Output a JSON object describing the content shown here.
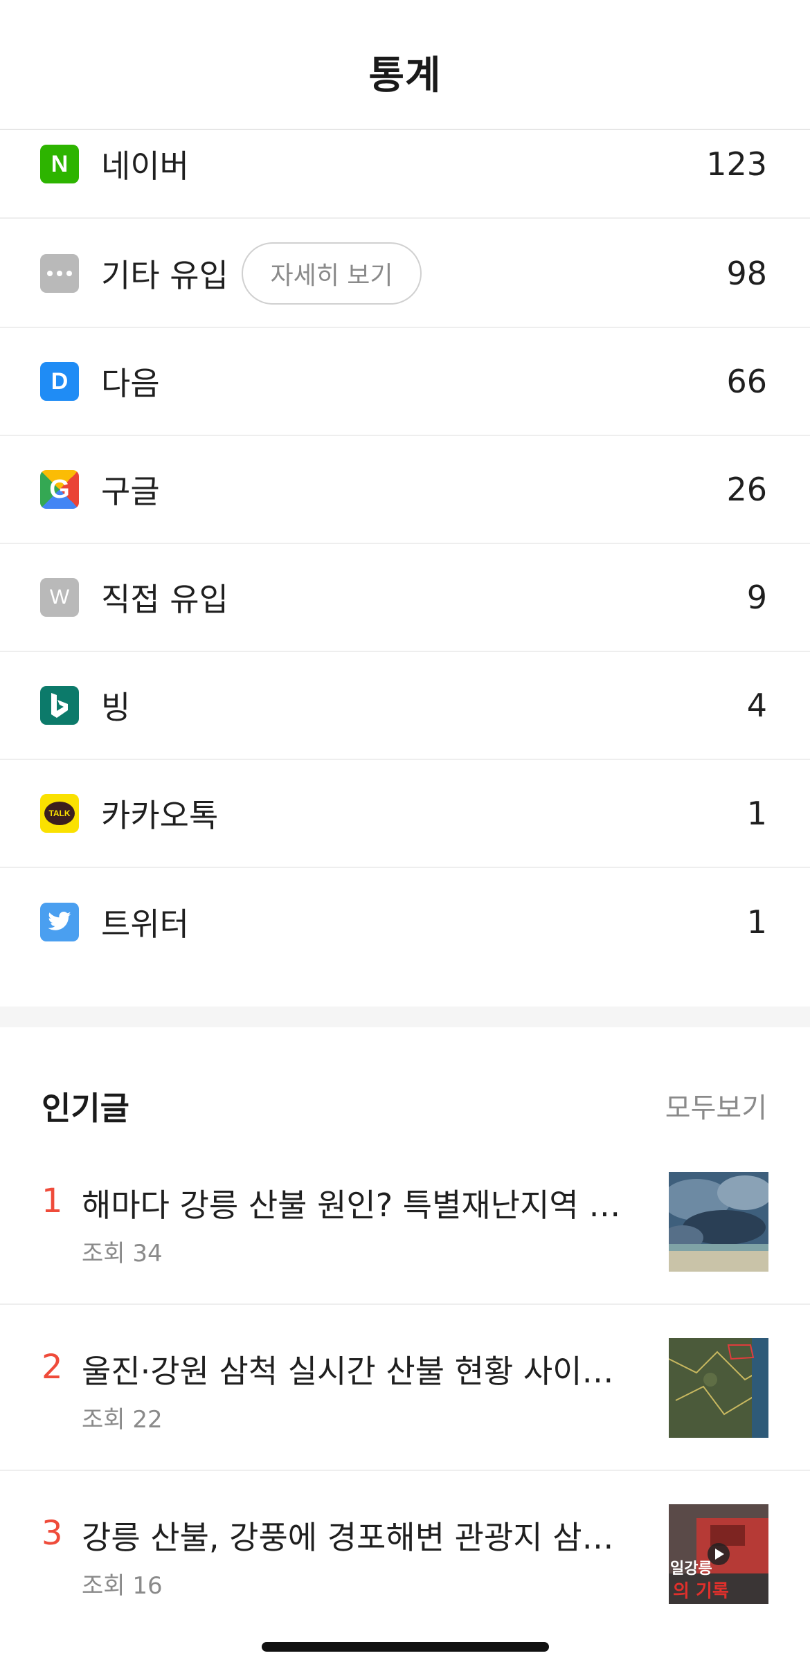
{
  "header": {
    "title": "통계"
  },
  "referrers": [
    {
      "icon": "naver-icon",
      "label": "네이버",
      "count": "123"
    },
    {
      "icon": "more-icon",
      "label": "기타 유입",
      "count": "98",
      "detail_button": "자세히 보기"
    },
    {
      "icon": "daum-icon",
      "label": "다음",
      "count": "66"
    },
    {
      "icon": "google-icon",
      "label": "구글",
      "count": "26"
    },
    {
      "icon": "direct-icon",
      "label": "직접 유입",
      "count": "9"
    },
    {
      "icon": "bing-icon",
      "label": "빙",
      "count": "4"
    },
    {
      "icon": "kakaotalk-icon",
      "label": "카카오톡",
      "count": "1"
    },
    {
      "icon": "twitter-icon",
      "label": "트위터",
      "count": "1"
    }
  ],
  "icon_text": {
    "naver": "N",
    "daum": "D",
    "direct": "W",
    "kakaotalk": "TALK"
  },
  "popular": {
    "title": "인기글",
    "see_all": "모두보기",
    "posts": [
      {
        "rank": "1",
        "title": "해마다 강릉 산불 원인? 특별재난지역 선포",
        "views": "조회 34"
      },
      {
        "rank": "2",
        "title": "울진·강원 삼척 실시간 산불 현황 사이트 정리",
        "views": "조회 22"
      },
      {
        "rank": "3",
        "title": "강릉 산불, 강풍에 경포해변 관광지 삼키며 확산",
        "views": "조회 16"
      }
    ],
    "thumb3_text_1": "일강릉",
    "thumb3_text_2": "의 기록"
  },
  "colors": {
    "rank": "#ef4b3a",
    "naver": "#2db400",
    "daum": "#1f8cf5",
    "bing": "#0c7a6a",
    "kakao": "#fae100",
    "twitter": "#4a9ff0",
    "gray_icon": "#b9b9b9"
  }
}
